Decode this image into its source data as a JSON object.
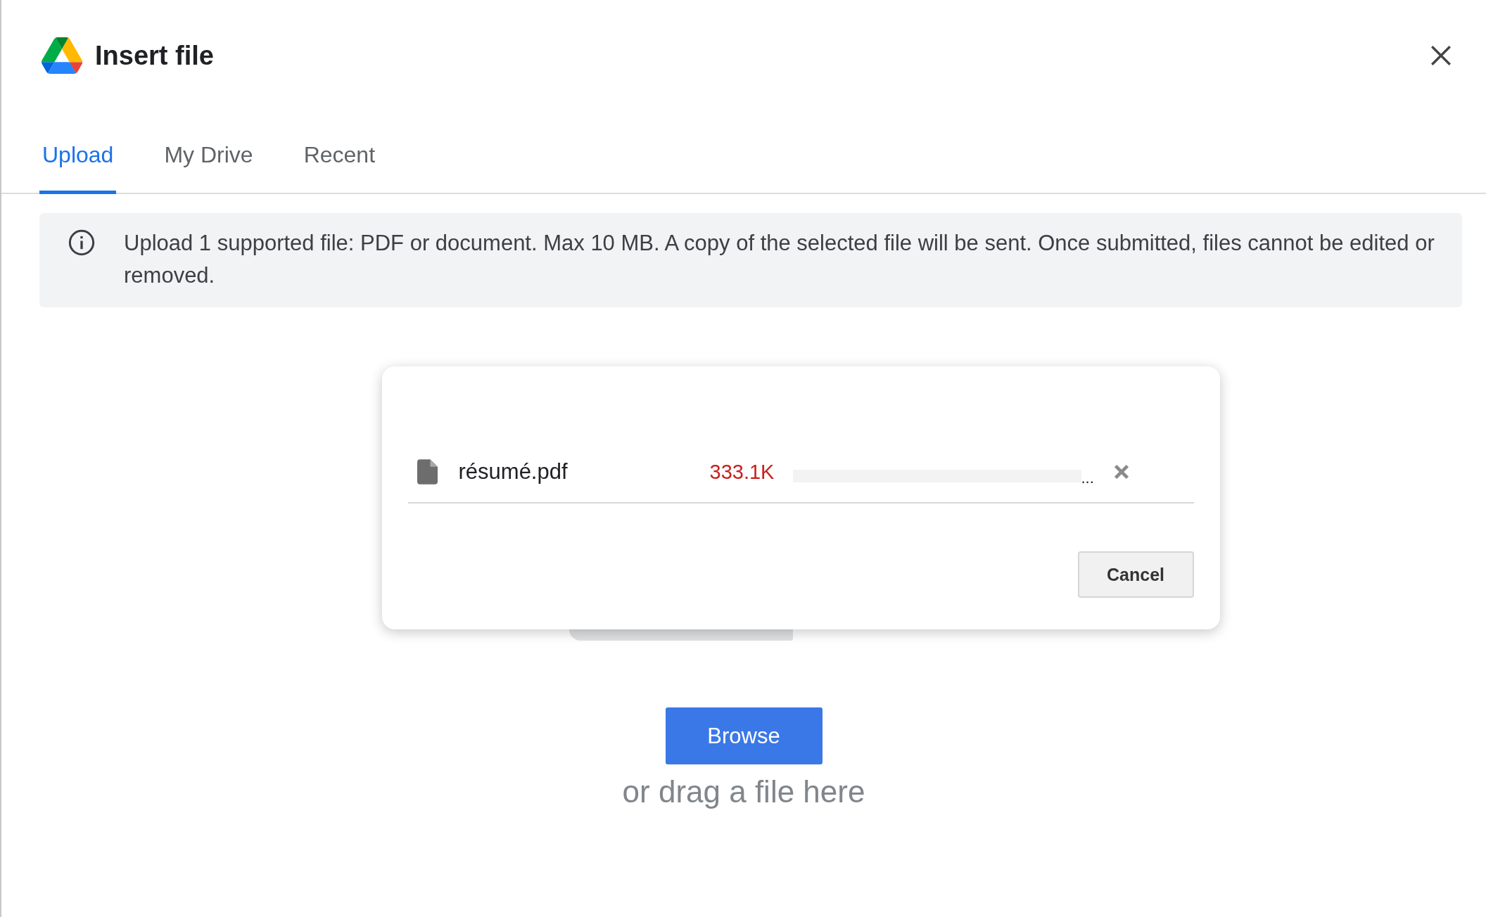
{
  "window": {
    "title": "Insert file"
  },
  "tabs": [
    {
      "label": "Upload",
      "selected": true
    },
    {
      "label": "My Drive",
      "selected": false
    },
    {
      "label": "Recent",
      "selected": false
    }
  ],
  "info_banner": {
    "text": "Upload 1 supported file: PDF or document. Max 10 MB. A copy of the selected file will be sent. Once submitted, files cannot be edited or removed."
  },
  "upload_dialog": {
    "file": {
      "name": "résumé.pdf",
      "size": "333.1K",
      "status": "..."
    },
    "buttons": [
      "Cancel"
    ]
  },
  "browse_button": "Browse",
  "drop_hint": "or drag a file here"
}
